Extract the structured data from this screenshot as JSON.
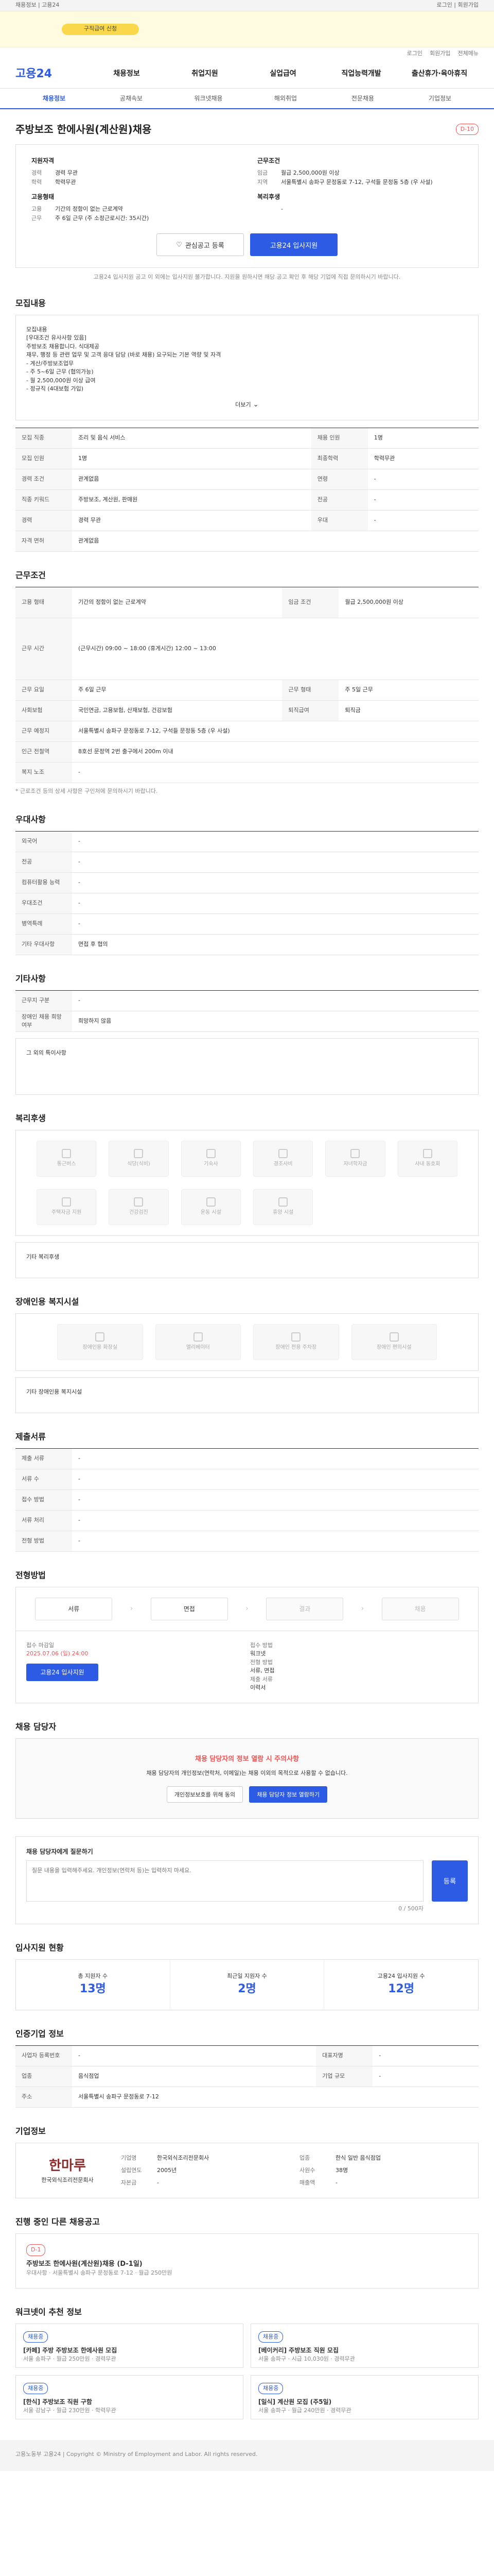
{
  "topbar": {
    "left": "채용정보 | 고용24",
    "right": "로그인 | 회원가입"
  },
  "hero": {
    "pill": "구직급여 신청"
  },
  "util": [
    "로그인",
    "회원가입",
    "전체메뉴"
  ],
  "logo": "고용24",
  "gnb": [
    "채용정보",
    "취업지원",
    "실업급여",
    "직업능력개발",
    "출산휴가·육아휴직"
  ],
  "subnav": [
    "채용정보",
    "공채속보",
    "워크넷채용",
    "해외취업",
    "전문채용",
    "기업정보"
  ],
  "title": "주방보조 한에사원(계산원)채용",
  "title_badge": "D-10",
  "summary": {
    "left_title": "지원자격",
    "left": [
      [
        "경력",
        "경력 무관"
      ],
      [
        "학력",
        "학력무관"
      ]
    ],
    "right_title": "근무조건",
    "right": [
      [
        "임금",
        "월급 2,500,000원 이상"
      ],
      [
        "지역",
        "서울특별시 송파구 문정동로 7-12, 구석들 문정동 5층 (우 사설)"
      ]
    ],
    "left2_title": "고용형태",
    "left2": [
      [
        "고용",
        "기간의 정함이 없는 근로계약"
      ],
      [
        "근무",
        "주 6일 근무 (주 소정근로시간: 35시간)"
      ]
    ],
    "right2_title": "복리후생",
    "right2": [
      [
        "",
        "-"
      ]
    ],
    "scrap_btn": "관심공고 등록",
    "apply_btn": "고용24 입사지원",
    "note": "고용24 입사지원 공고 이 외에는 입사지원 불가합니다. 지원을 원하시면 해당 공고 확인 후 해당 기업에 직접 문의하시기 바랍니다."
  },
  "sections": {
    "recruit": "모집내용",
    "work": "근무조건",
    "pref": "우대사항",
    "etc": "기타사항",
    "welfare": "복리후생",
    "disabled": "장애인용 복지시설",
    "docs": "제출서류",
    "process": "전형방법",
    "contact": "채용 담당자",
    "stats": "입사지원 현황",
    "company": "인증기업 정보",
    "company2": "기업정보",
    "others": "진행 중인 다른 채용공고",
    "recommend": "워크넷이 추천 정보"
  },
  "recruit": {
    "desc": [
      "모집내용",
      "[우대조건 유사사항 있음]",
      "주방보조 채용합니다. 식대제공",
      "재무, 행정 등 관련 업무 및 고객 응대 담당 (바로 채용) 요구되는 기본 역량 및 자격",
      "- 계산/주방보조업무",
      "- 주 5~6일 근무 (협의가능)",
      "- 월 2,500,000원 이상 급여",
      "- 정규직 (4대보험 가입)"
    ],
    "more": "더보기",
    "rows": [
      [
        "모집 직종",
        "조리 및 음식 서비스",
        "채용 인원",
        "1명"
      ],
      [
        "모집 인원",
        "1명",
        "최종학력",
        "학력무관"
      ],
      [
        "경력 조건",
        "관계없음",
        "연령",
        "-"
      ],
      [
        "직종 키워드",
        "주방보조, 계산원, 판매원",
        "전공",
        "-"
      ],
      [
        "경력",
        "경력 무관",
        "우대",
        "-"
      ],
      [
        "자격 면허",
        "관계없음",
        "",
        ""
      ]
    ]
  },
  "work": {
    "rows": [
      [
        "고용 형태",
        "기간의 정함이 없는 근로계약",
        "임금 조건",
        "월급 2,500,000원 이상"
      ],
      [
        "근무 시간",
        "(근무시간) 09:00 ~ 18:00 (휴게시간) 12:00 ~ 13:00",
        "",
        ""
      ],
      [
        "근무 요일",
        "주 6일 근무",
        "근무 형태",
        "주 5일 근무"
      ],
      [
        "사회보험",
        "국민연금, 고용보험, 산재보험, 건강보험",
        "퇴직급여",
        "퇴직금"
      ],
      [
        "근무 예정지",
        "서울특별시 송파구 문정동로 7-12, 구석들 문정동 5층 (우 사설)",
        "",
        ""
      ],
      [
        "인근 전철역",
        "8호선 문정역 2번 출구에서 200m 이내",
        "",
        ""
      ],
      [
        "복지 노조",
        "-",
        "",
        ""
      ]
    ],
    "note": "* 근로조건 등의 상세 사항은 구인처에 문의하시기 바랍니다."
  },
  "pref": {
    "rows": [
      [
        "외국어",
        "-"
      ],
      [
        "전공",
        "-"
      ],
      [
        "컴퓨터활용 능력",
        "-"
      ],
      [
        "우대조건",
        "-"
      ],
      [
        "병역특례",
        "-"
      ],
      [
        "기타 우대사항",
        "면접 후 협의"
      ]
    ]
  },
  "etc": {
    "rows": [
      [
        "근무지 구분",
        "-"
      ],
      [
        "장애인 채용 희망 여부",
        "희망하지 않음"
      ]
    ],
    "note": "그 외의 특이사항"
  },
  "welfare": {
    "items": [
      "통근버스",
      "식당(식비)",
      "기숙사",
      "경조사비",
      "자녀학자금",
      "사내 동호회",
      "주택자금 지원",
      "건강검진",
      "운동 시설",
      "휴양 시설"
    ],
    "etc_label": "기타 복리후생"
  },
  "disabled": {
    "items": [
      "장애인용 화장실",
      "엘리베이터",
      "장애인 전용 주차장",
      "장애인 편의시설"
    ],
    "etc_label": "기타 장애인용 복지시설"
  },
  "docs": {
    "rows": [
      [
        "제출 서류",
        "-"
      ],
      [
        "서류 수",
        "-"
      ],
      [
        "접수 방법",
        "-"
      ],
      [
        "서류 처리",
        "-"
      ],
      [
        "전형 방법",
        "-"
      ]
    ]
  },
  "process": {
    "steps": [
      "서류",
      "면접",
      "결과",
      "채용"
    ],
    "info": [
      [
        "접수 마감일",
        "2025.07.06 (일) 24:00"
      ],
      [
        "접수 방법",
        "워크넷"
      ],
      [
        "전형 방법",
        "서류, 면접"
      ],
      [
        "제출 서류",
        "이력서"
      ]
    ],
    "apply_btn": "고용24 입사지원"
  },
  "contact": {
    "title": "채용 담당자의 정보 열람 시 주의사항",
    "body": "채용 담당자의 개인정보(연락처, 이메일)는 채용 이외의 목적으로 사용할 수 없습니다.",
    "btn1": "개인정보보호를 위해 동의",
    "btn2": "채용 담당자 정보 열람하기"
  },
  "qa": {
    "title": "채용 담당자에게 질문하기",
    "placeholder": "질문 내용을 입력해주세요. 개인정보(연락처 등)는 입력하지 마세요.",
    "counter": "0 / 500자",
    "submit": "등록"
  },
  "stats": [
    [
      "총 지원자 수",
      "13명"
    ],
    [
      "최근일 지원자 수",
      "2명"
    ],
    [
      "고용24 입사지원 수",
      "12명"
    ]
  ],
  "company": {
    "rows": [
      [
        "사업자 등록번호",
        "-",
        "대표자명",
        "-"
      ],
      [
        "업종",
        "음식점업",
        "기업 규모",
        "-"
      ],
      [
        "주소",
        "서울특별시 송파구 문정동로 7-12",
        "",
        ""
      ]
    ]
  },
  "company2": {
    "logo": "한마루",
    "name": "한국외식조리전문회사",
    "rows": [
      [
        "기업명",
        "한국외식조리전문회사"
      ],
      [
        "업종",
        "한식 일반 음식점업"
      ],
      [
        "설립연도",
        "2005년"
      ],
      [
        "사원수",
        "38명"
      ],
      [
        "자본금",
        "-"
      ],
      [
        "매출액",
        "-"
      ]
    ]
  },
  "others": [
    {
      "title": "주방보조 한에사원(계산원)채용 (D-1일)",
      "sub": "우대사항 · 서울특별시 송파구 문정동로 7-12 · 월급 250만원",
      "dday": "D-1"
    }
  ],
  "recommend": [
    {
      "tag": "채용중",
      "title": "[카페] 주방 주방보조 한에사원 모집",
      "sub": "서울 송파구 · 월급 250만원 · 경력무관"
    },
    {
      "tag": "채용중",
      "title": "[베이커리] 주방보조 직원 모집",
      "sub": "서울 송파구 · 시급 10,030원 · 경력무관"
    },
    {
      "tag": "채용중",
      "title": "[한식] 주방보조 직원 구함",
      "sub": "서울 강남구 · 월급 230만원 · 학력무관"
    },
    {
      "tag": "채용중",
      "title": "[일식] 계산원 모집 (주5일)",
      "sub": "서울 송파구 · 월급 240만원 · 경력무관"
    }
  ],
  "footer": "고용노동부 고용24 | Copyright © Ministry of Employment and Labor. All rights reserved."
}
